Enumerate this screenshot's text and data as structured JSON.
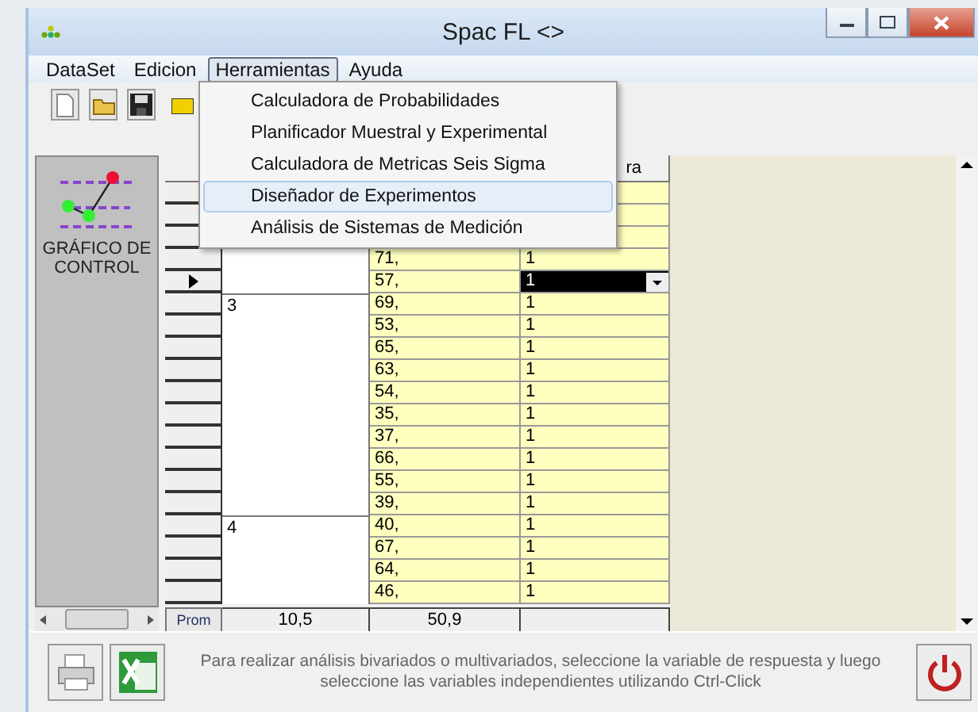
{
  "window": {
    "title": "Spac FL <>"
  },
  "menu_bar": [
    {
      "label": "DataSet",
      "selected": false
    },
    {
      "label": "Edicion",
      "selected": false
    },
    {
      "label": "Herramientas",
      "selected": true
    },
    {
      "label": "Ayuda",
      "selected": false
    }
  ],
  "dropdown_menu": [
    {
      "label": "Calculadora de Probabilidades",
      "selected": false
    },
    {
      "label": "Planificador Muestral y Experimental",
      "selected": false
    },
    {
      "label": "Calculadora de Metricas Seis Sigma",
      "selected": false
    },
    {
      "label": "Diseñador de Experimentos",
      "selected": true
    },
    {
      "label": "Análisis de Sistemas de Medición",
      "selected": false
    }
  ],
  "side_panel": {
    "label": "GRÁFICO DE CONTROL"
  },
  "table": {
    "column_3_label": "ra",
    "groups": [
      {
        "rows": [
          {
            "selected": false
          },
          {
            "selected": false
          },
          {
            "selected": false
          },
          {
            "value": "71,",
            "column_3": "1",
            "selected": false
          },
          {
            "value": "57,",
            "column_3": "1",
            "selected": true
          }
        ]
      },
      {
        "label": "3",
        "rows": [
          {
            "value": "69,",
            "column_3": "1",
            "selected": false
          },
          {
            "value": "53,",
            "column_3": "1",
            "selected": false
          },
          {
            "value": "65,",
            "column_3": "1",
            "selected": false
          },
          {
            "value": "63,",
            "column_3": "1",
            "selected": false
          },
          {
            "value": "54,",
            "column_3": "1",
            "selected": false
          },
          {
            "value": "35,",
            "column_3": "1",
            "selected": false
          },
          {
            "value": "37,",
            "column_3": "1",
            "selected": false
          },
          {
            "value": "66,",
            "column_3": "1",
            "selected": false
          },
          {
            "value": "55,",
            "column_3": "1",
            "selected": false
          },
          {
            "value": "39,",
            "column_3": "1",
            "selected": false
          }
        ]
      },
      {
        "label": "4",
        "rows": [
          {
            "value": "40,",
            "column_3": "1",
            "selected": false
          },
          {
            "value": "67,",
            "column_3": "1",
            "selected": false
          },
          {
            "value": "64,",
            "column_3": "1",
            "selected": false
          },
          {
            "value": "46,",
            "column_3": "1",
            "selected": false
          }
        ]
      }
    ],
    "footer": {
      "label": "Prom",
      "values": [
        "10,5",
        "50,9"
      ]
    }
  },
  "hint": "Para realizar análisis bivariados o multivariados, seleccione la variable de respuesta y luego seleccione las variables independientes utilizando Ctrl-Click"
}
